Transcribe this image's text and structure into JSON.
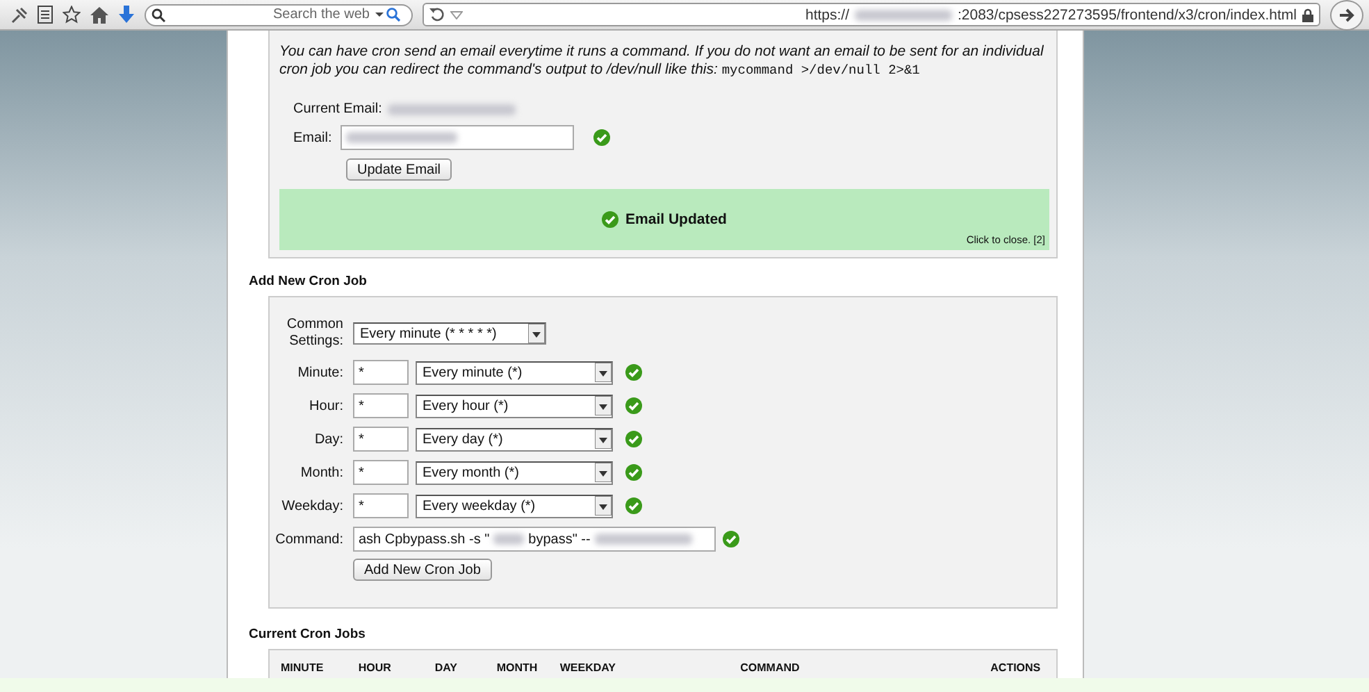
{
  "browser": {
    "search_placeholder": "Search the web",
    "url_prefix": "https://",
    "url_suffix": ":2083/cpsess227273595/frontend/x3/cron/index.html"
  },
  "email_section": {
    "notice": "You can have cron send an email everytime it runs a command. If you do not want an email to be sent for an individual cron job you can redirect the command's output to /dev/null like this: ",
    "notice_code": "mycommand >/dev/null 2>&1",
    "current_email_label": "Current Email:",
    "email_label": "Email:",
    "email_valid": true,
    "update_button": "Update Email",
    "message": "Email Updated",
    "close_hint": "Click to close. [2]"
  },
  "add_job": {
    "heading": "Add New Cron Job",
    "common_label": "Common Settings:",
    "common_value": "Every minute (* * * * *)",
    "fields": [
      {
        "label": "Minute:",
        "value": "*",
        "option": "Every minute (*)",
        "valid": true
      },
      {
        "label": "Hour:",
        "value": "*",
        "option": "Every hour (*)",
        "valid": true
      },
      {
        "label": "Day:",
        "value": "*",
        "option": "Every day (*)",
        "valid": true
      },
      {
        "label": "Month:",
        "value": "*",
        "option": "Every month (*)",
        "valid": true
      },
      {
        "label": "Weekday:",
        "value": "*",
        "option": "Every weekday (*)",
        "valid": true
      }
    ],
    "command_label": "Command:",
    "command_parts": [
      "ash Cpbypass.sh -s \"",
      "bypass\" --"
    ],
    "command_valid": true,
    "submit_button": "Add New Cron Job"
  },
  "current_jobs": {
    "heading": "Current Cron Jobs",
    "columns": [
      "MINUTE",
      "HOUR",
      "DAY",
      "MONTH",
      "WEEKDAY",
      "COMMAND",
      "ACTIONS"
    ]
  }
}
